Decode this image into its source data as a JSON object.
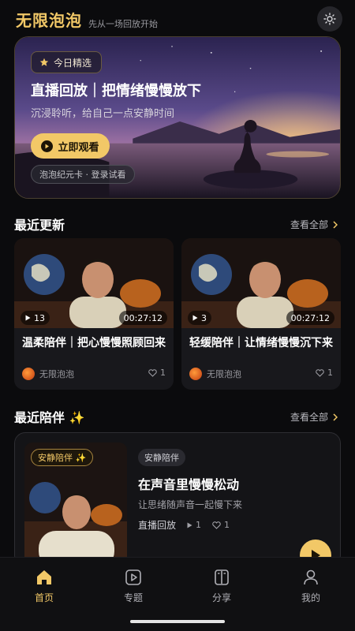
{
  "header": {
    "app_name": "无限泡泡",
    "slogan": "先从一场回放开始",
    "theme_icon": "sun-icon"
  },
  "hero": {
    "badge": "今日精选",
    "title": "直播回放｜把情绪慢慢放下",
    "subtitle": "沉浸聆听，给自己一点安静时间",
    "button_label": "立即观看",
    "card_tag": "泡泡纪元卡 · 登录试看"
  },
  "recent_updates": {
    "title": "最近更新",
    "see_all": "查看全部",
    "cards": [
      {
        "views": "13",
        "duration": "00:27:12",
        "title": "温柔陪伴｜把心慢慢照顾回来",
        "author": "无限泡泡",
        "likes": "1"
      },
      {
        "views": "3",
        "duration": "00:27:12",
        "title": "轻缓陪伴｜让情绪慢慢沉下来",
        "author": "无限泡泡",
        "likes": "1"
      }
    ]
  },
  "recent_companion": {
    "title": "最近陪伴 ✨",
    "see_all": "查看全部",
    "item": {
      "badge": "安静陪伴 ✨",
      "tag": "安静陪伴",
      "title": "在声音里慢慢松动",
      "subtitle": "让思绪随声音一起慢下来",
      "type": "直播回放",
      "plays": "1",
      "likes": "1"
    }
  },
  "bottom_nav": [
    {
      "label": "首页",
      "icon": "home-icon",
      "active": true
    },
    {
      "label": "专题",
      "icon": "play-square-icon",
      "active": false
    },
    {
      "label": "分享",
      "icon": "book-icon",
      "active": false
    },
    {
      "label": "我的",
      "icon": "user-icon",
      "active": false
    }
  ],
  "colors": {
    "accent": "#f2c867",
    "background": "#0b0b0d",
    "card": "#18181c"
  }
}
